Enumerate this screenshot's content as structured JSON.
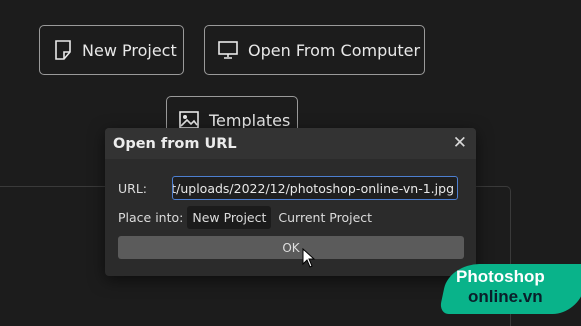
{
  "start": {
    "new_project": "New Project",
    "open_computer": "Open From Computer",
    "templates": "Templates"
  },
  "dialog": {
    "title": "Open from URL",
    "close_icon": "close-icon",
    "url_label": "URL:",
    "url_value": "t/uploads/2022/12/photoshop-online-vn-1.jpg",
    "place_into_label": "Place into:",
    "options": [
      "New Project",
      "Current Project"
    ],
    "selected_option": "New Project",
    "ok_label": "OK"
  },
  "watermark": {
    "line1": "Photoshop",
    "line2": "online.vn"
  },
  "colors": {
    "background": "#1c1c1c",
    "dialog": "#2b2b2b",
    "input_focus": "#4d7fd1",
    "ok_button": "#5b5b5b",
    "brand": "#09b38a"
  }
}
